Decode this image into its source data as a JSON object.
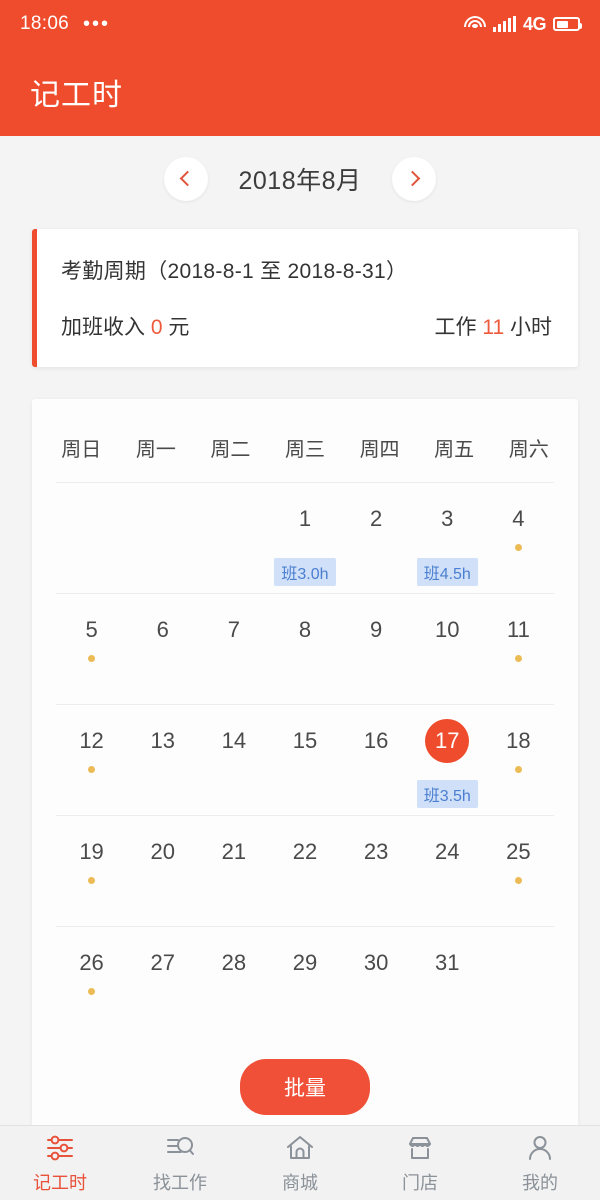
{
  "status_bar": {
    "time": "18:06",
    "menu_dots": "•••",
    "network_label": "4G",
    "icons": [
      "wifi-icon",
      "signal-bars-icon",
      "battery-icon"
    ]
  },
  "app_bar": {
    "title": "记工时"
  },
  "month_nav": {
    "prev_label": "chevron-left-icon",
    "next_label": "chevron-right-icon",
    "month_label": "2018年8月"
  },
  "summary": {
    "period_title": "考勤周期（2018-8-1 至 2018-8-31）",
    "overtime_prefix": "加班收入",
    "overtime_value": "0",
    "overtime_suffix": "元",
    "work_prefix": "工作",
    "work_value": "11",
    "work_suffix": "小时"
  },
  "calendar": {
    "weekdays": [
      "周日",
      "周一",
      "周二",
      "周三",
      "周四",
      "周五",
      "周六"
    ],
    "selected_day": 17,
    "weeks": [
      [
        {
          "day": ""
        },
        {
          "day": ""
        },
        {
          "day": ""
        },
        {
          "day": "1",
          "badge": "班3.0h"
        },
        {
          "day": "2"
        },
        {
          "day": "3",
          "badge": "班4.5h"
        },
        {
          "day": "4",
          "dot": true
        }
      ],
      [
        {
          "day": "5",
          "dot": true
        },
        {
          "day": "6"
        },
        {
          "day": "7"
        },
        {
          "day": "8"
        },
        {
          "day": "9"
        },
        {
          "day": "10"
        },
        {
          "day": "11",
          "dot": true
        }
      ],
      [
        {
          "day": "12",
          "dot": true
        },
        {
          "day": "13"
        },
        {
          "day": "14"
        },
        {
          "day": "15"
        },
        {
          "day": "16"
        },
        {
          "day": "17",
          "selected": true,
          "badge": "班3.5h"
        },
        {
          "day": "18",
          "dot": true
        }
      ],
      [
        {
          "day": "19",
          "dot": true
        },
        {
          "day": "20"
        },
        {
          "day": "21"
        },
        {
          "day": "22"
        },
        {
          "day": "23"
        },
        {
          "day": "24"
        },
        {
          "day": "25",
          "dot": true
        }
      ],
      [
        {
          "day": "26",
          "dot": true
        },
        {
          "day": "27"
        },
        {
          "day": "28"
        },
        {
          "day": "29"
        },
        {
          "day": "30"
        },
        {
          "day": "31"
        },
        {
          "day": ""
        }
      ]
    ]
  },
  "batch_button": {
    "label": "批量"
  },
  "bottom_nav": {
    "items": [
      {
        "label": "记工时",
        "icon": "sliders-icon",
        "active": true
      },
      {
        "label": "找工作",
        "icon": "job-search-icon",
        "active": false
      },
      {
        "label": "商城",
        "icon": "home-icon",
        "active": false
      },
      {
        "label": "门店",
        "icon": "store-icon",
        "active": false
      },
      {
        "label": "我的",
        "icon": "person-icon",
        "active": false
      }
    ]
  },
  "colors": {
    "brand_red": "#ef4b2d",
    "accent_orange": "#ef5a3c",
    "dot_gold": "#ecbb55",
    "badge_bg": "#cfe0f8",
    "badge_text": "#4b7fd0",
    "page_bg": "#f4f4f4",
    "nav_inactive": "#8b9299"
  }
}
